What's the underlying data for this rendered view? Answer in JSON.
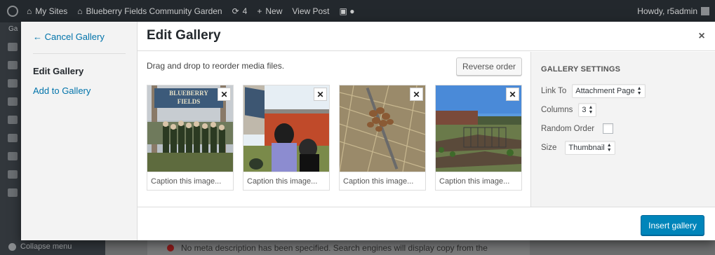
{
  "adminbar": {
    "my_sites": "My Sites",
    "site_name": "Blueberry Fields Community Garden",
    "updates": "4",
    "new": "New",
    "view_post": "View Post",
    "howdy": "Howdy, r5admin"
  },
  "background": {
    "notice": "No meta description has been specified. Search engines will display copy from the",
    "collapse": "Collapse menu",
    "sidemenu_label": "Ga"
  },
  "menu": {
    "cancel": "← Cancel Gallery",
    "active": "Edit Gallery",
    "add": "Add to Gallery"
  },
  "title": "Edit Gallery",
  "close_glyph": "×",
  "content": {
    "hint": "Drag and drop to reorder media files.",
    "reverse": "Reverse order",
    "remove_glyph": "✕",
    "attachments": [
      {
        "caption": "Caption this image...",
        "sign_line1": "BLUEBERRY",
        "sign_line2": "FIELDS"
      },
      {
        "caption": "Caption this image..."
      },
      {
        "caption": "Caption this image..."
      },
      {
        "caption": "Caption this image..."
      }
    ]
  },
  "settings": {
    "heading": "GALLERY SETTINGS",
    "link_to_label": "Link To",
    "link_to_value": "Attachment Page",
    "columns_label": "Columns",
    "columns_value": "3",
    "random_label": "Random Order",
    "random_checked": false,
    "size_label": "Size",
    "size_value": "Thumbnail"
  },
  "toolbar": {
    "insert": "Insert gallery"
  },
  "colors": {
    "primary": "#0085ba",
    "link": "#0073aa",
    "adminbar": "#23282d"
  }
}
